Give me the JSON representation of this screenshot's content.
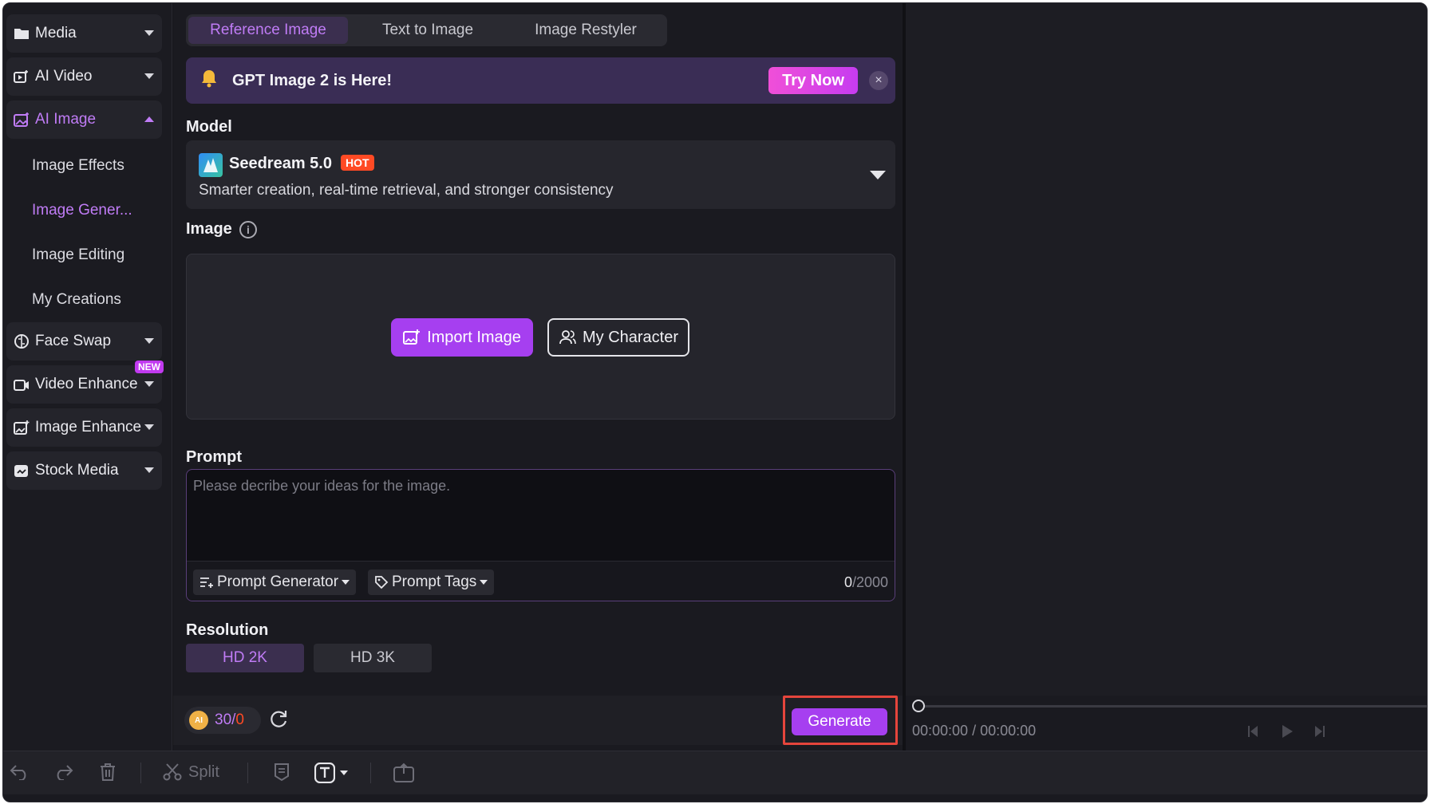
{
  "sidebar": {
    "items": [
      {
        "label": "Media",
        "icon": "folder-icon"
      },
      {
        "label": "AI Video",
        "icon": "ai-video-icon"
      },
      {
        "label": "AI Image",
        "icon": "ai-image-icon",
        "expanded": true
      },
      {
        "label": "Face Swap",
        "icon": "face-swap-icon"
      },
      {
        "label": "Video Enhance",
        "icon": "video-enhance-icon",
        "badge": "NEW"
      },
      {
        "label": "Image Enhance",
        "icon": "image-enhance-icon"
      },
      {
        "label": "Stock Media",
        "icon": "stock-media-icon"
      }
    ],
    "sub_items": [
      {
        "label": "Image Effects"
      },
      {
        "label": "Image Gener...",
        "active": true
      },
      {
        "label": "Image Editing"
      },
      {
        "label": "My Creations"
      }
    ]
  },
  "tabs": [
    "Reference Image",
    "Text to Image",
    "Image Restyler"
  ],
  "banner": {
    "title": "GPT Image 2 is Here!",
    "cta": "Try Now",
    "close": "×"
  },
  "model": {
    "section_label": "Model",
    "name": "Seedream 5.0",
    "badge": "HOT",
    "description": "Smarter creation, real-time retrieval, and stronger consistency"
  },
  "image": {
    "section_label": "Image",
    "info": "i",
    "import_label": "Import Image",
    "character_label": "My Character"
  },
  "prompt": {
    "section_label": "Prompt",
    "value": "",
    "placeholder": "Please decribe your ideas for the image.",
    "generator_label": "Prompt Generator",
    "tags_label": "Prompt Tags",
    "count": "0",
    "max": "/2000"
  },
  "resolution": {
    "section_label": "Resolution",
    "options": [
      "HD 2K",
      "HD 3K"
    ],
    "selected": "HD 2K"
  },
  "footer": {
    "coin_label": "AI",
    "credits_a": "30",
    "credits_sep": "/",
    "credits_b": "0",
    "generate_label": "Generate"
  },
  "preview": {
    "current_time": "00:00:00",
    "separator": " / ",
    "total_time": "00:00:00"
  },
  "toolbar": {
    "split_label": "Split"
  },
  "colors": {
    "accent": "#a63ff0",
    "accent_text": "#c07cf6",
    "hot": "#ff4a24",
    "highlight_border": "#e5453c"
  }
}
